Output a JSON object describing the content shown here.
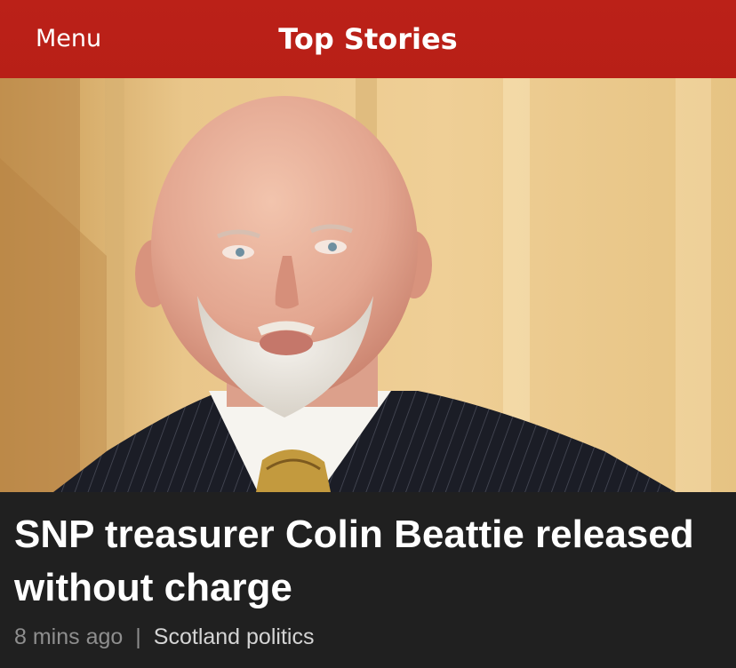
{
  "header": {
    "menu_label": "Menu",
    "title": "Top Stories",
    "bar_color": "#b81f17"
  },
  "hero": {
    "image_subject": "portrait-photo"
  },
  "story": {
    "headline": "SNP treasurer Colin Beattie released without charge",
    "timestamp": "8 mins ago",
    "separator": "|",
    "topic": "Scotland politics"
  }
}
